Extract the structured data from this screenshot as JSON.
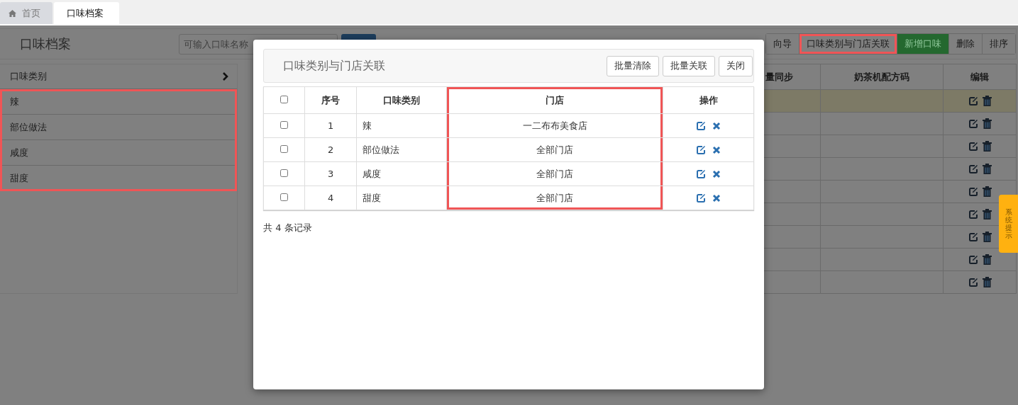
{
  "tabs": [
    {
      "label": "首页",
      "selected": false
    },
    {
      "label": "口味档案",
      "selected": true
    }
  ],
  "page": {
    "title": "口味档案",
    "search": {
      "placeholder": "可输入口味名称"
    },
    "toolbar": [
      {
        "label": "向导",
        "kind": "default",
        "highlighted": false
      },
      {
        "label": "口味类别与门店关联",
        "kind": "default",
        "highlighted": true
      },
      {
        "label": "新增口味",
        "kind": "success",
        "highlighted": false
      },
      {
        "label": "删除",
        "kind": "default",
        "highlighted": false
      },
      {
        "label": "排序",
        "kind": "default",
        "highlighted": false
      }
    ],
    "sidebar": {
      "header": "口味类别",
      "highlighted": true,
      "items": [
        {
          "label": "辣"
        },
        {
          "label": "部位做法"
        },
        {
          "label": "咸度"
        },
        {
          "label": "甜度"
        }
      ]
    },
    "table": {
      "columns": [
        "量同步",
        "奶茶机配方码",
        "编辑"
      ],
      "rows": [
        {
          "selected": true
        },
        {
          "selected": false
        },
        {
          "selected": false
        },
        {
          "selected": false
        },
        {
          "selected": false
        },
        {
          "selected": false
        },
        {
          "selected": false
        },
        {
          "selected": false
        },
        {
          "selected": false
        }
      ]
    }
  },
  "dialog": {
    "title": "口味类别与门店关联",
    "buttons": [
      "批量清除",
      "批量关联",
      "关闭"
    ],
    "table": {
      "all_checked": false,
      "columns": [
        {
          "label": "序号",
          "highlighted": false
        },
        {
          "label": "口味类别",
          "highlighted": false
        },
        {
          "label": "门店",
          "highlighted": true
        },
        {
          "label": "操作",
          "highlighted": false
        }
      ],
      "rows": [
        {
          "checked": false,
          "index": "1",
          "category": "辣",
          "store": "一二布布美食店"
        },
        {
          "checked": false,
          "index": "2",
          "category": "部位做法",
          "store": "全部门店"
        },
        {
          "checked": false,
          "index": "3",
          "category": "咸度",
          "store": "全部门店"
        },
        {
          "checked": false,
          "index": "4",
          "category": "甜度",
          "store": "全部门店"
        }
      ]
    },
    "footer": "共 4 条记录"
  },
  "side_tab": {
    "label": "系统提示"
  }
}
